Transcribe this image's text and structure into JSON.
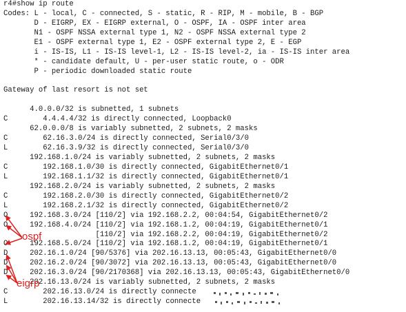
{
  "terminal": {
    "lines": [
      "r4#show ip route",
      "Codes: L - local, C - connected, S - static, R - RIP, M - mobile, B - BGP",
      "       D - EIGRP, EX - EIGRP external, O - OSPF, IA - OSPF inter area",
      "       N1 - OSPF NSSA external type 1, N2 - OSPF NSSA external type 2",
      "       E1 - OSPF external type 1, E2 - OSPF external type 2, E - EGP",
      "       i - IS-IS, L1 - IS-IS level-1, L2 - IS-IS level-2, ia - IS-IS inter area",
      "       * - candidate default, U - per-user static route, o - ODR",
      "       P - periodic downloaded static route",
      "",
      "Gateway of last resort is not set",
      "",
      "      4.0.0.0/32 is subnetted, 1 subnets",
      "C        4.4.4.4/32 is directly connected, Loopback0",
      "      62.0.0.0/8 is variably subnetted, 2 subnets, 2 masks",
      "C        62.16.3.0/24 is directly connected, Serial0/3/0",
      "L        62.16.3.9/32 is directly connected, Serial0/3/0",
      "      192.168.1.0/24 is variably subnetted, 2 subnets, 2 masks",
      "C        192.168.1.0/30 is directly connected, GigabitEthernet0/1",
      "L        192.168.1.1/32 is directly connected, GigabitEthernet0/1",
      "      192.168.2.0/24 is variably subnetted, 2 subnets, 2 masks",
      "C        192.168.2.0/30 is directly connected, GigabitEthernet0/2",
      "L        192.168.2.1/32 is directly connected, GigabitEthernet0/2",
      "O     192.168.3.0/24 [110/2] via 192.168.2.2, 00:04:54, GigabitEthernet0/2",
      "O     192.168.4.0/24 [110/2] via 192.168.1.2, 00:04:19, GigabitEthernet0/1",
      "                     [110/2] via 192.168.2.2, 00:04:19, GigabitEthernet0/2",
      "O     192.168.5.0/24 [110/2] via 192.168.1.2, 00:04:19, GigabitEthernet0/1",
      "D     202.16.1.0/24 [90/5376] via 202.16.13.13, 00:05:43, GigabitEthernet0/0",
      "D     202.16.2.0/24 [90/3072] via 202.16.13.13, 00:05:43, GigabitEthernet0/0",
      "D     202.16.3.0/24 [90/2170368] via 202.16.13.13, 00:05:43, GigabitEthernet0/0",
      "      202.16.13.0/24 is variably subnetted, 2 subnets, 2 masks",
      "C        202.16.13.0/24 is directly connecte",
      "L        202.16.13.14/32 is directly connecte",
      "  "
    ]
  },
  "annotations": {
    "ospf_label": "ospf",
    "eigrp_label": "eigrp",
    "arrow_color": "#e02020"
  }
}
